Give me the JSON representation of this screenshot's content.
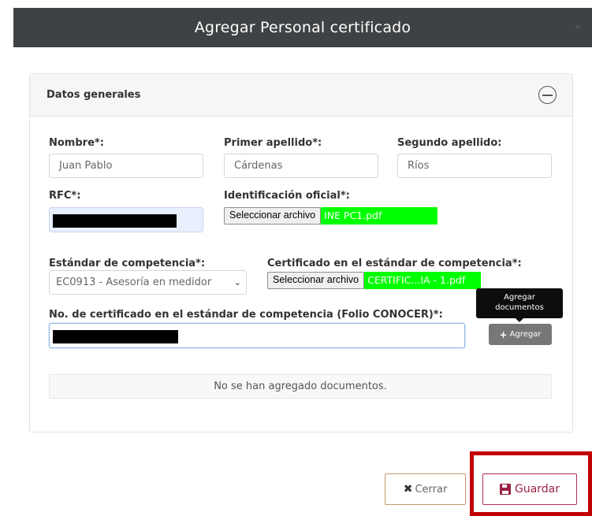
{
  "modal": {
    "title": "Agregar Personal certificado",
    "close_glyph": "×"
  },
  "panel": {
    "title": "Datos generales",
    "collapse_icon": "minus-circle-icon"
  },
  "fields": {
    "nombre": {
      "label": "Nombre*:",
      "value": "Juan Pablo"
    },
    "primer_apellido": {
      "label": "Primer apellido*:",
      "value": "Cárdenas"
    },
    "segundo_apellido": {
      "label": "Segundo apellido:",
      "value": "Ríos"
    },
    "rfc": {
      "label": "RFC*:"
    },
    "identificacion": {
      "label": "Identificación oficial*:",
      "button": "Seleccionar archivo",
      "file": "INE PC1.pdf"
    },
    "estandar": {
      "label": "Estándar de competencia*:",
      "value": "EC0913 - Asesoría en medidor"
    },
    "certificado": {
      "label": "Certificado en el estándar de competencia*:",
      "button": "Seleccionar archivo",
      "file": "CERTIFIC...IA - 1.pdf"
    },
    "folio": {
      "label": "No. de certificado en el estándar de competencia (Folio CONOCER)*:"
    }
  },
  "tooltip": {
    "line1": "Agregar",
    "line2": "documentos"
  },
  "add_button": {
    "icon": "+",
    "label": "Agregar"
  },
  "empty_message": "No se han agregado documentos.",
  "footer": {
    "close_label": "Cerrar",
    "close_icon": "✖",
    "save_label": "Guardar"
  },
  "colors": {
    "header_bg": "#3f4244",
    "file_highlight": "#00ff00",
    "save_accent": "#9b2242",
    "annotation_box": "#c00000"
  }
}
